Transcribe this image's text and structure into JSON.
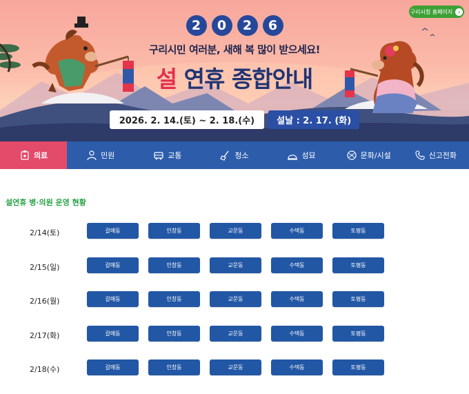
{
  "hero": {
    "year_digits": [
      "2",
      "0",
      "2",
      "6"
    ],
    "greeting": "구리시민 여러분, 새해 복 많이 받으세요!",
    "title_highlight": "설",
    "title_rest": "연휴 종합안내",
    "date_range": "2026. 2. 14.(토) ~ 2. 18.(수)",
    "seollal": "설날 : 2. 17. (화)",
    "home_link": "구리시청 홈페이지",
    "home_arrow_icon": "arrow-right-icon"
  },
  "nav": {
    "items": [
      {
        "label": "의료",
        "icon": "medical-icon"
      },
      {
        "label": "민원",
        "icon": "civil-icon"
      },
      {
        "label": "교통",
        "icon": "transport-icon"
      },
      {
        "label": "청소",
        "icon": "cleaning-icon"
      },
      {
        "label": "성묘",
        "icon": "grave-icon"
      },
      {
        "label": "문화/시설",
        "icon": "culture-icon"
      },
      {
        "label": "신고전화",
        "icon": "phone-icon"
      }
    ],
    "active_color": "#e44a6a",
    "bar_color": "#2d5cab"
  },
  "content": {
    "section_title": "설연휴 병·의원 운영 현황",
    "days": [
      {
        "date": "2/14(토)",
        "buttons": [
          "갈매동",
          "인창동",
          "교문동",
          "수택동",
          "토평동"
        ]
      },
      {
        "date": "2/15(일)",
        "buttons": [
          "갈매동",
          "인창동",
          "교문동",
          "수택동",
          "토평동"
        ]
      },
      {
        "date": "2/16(월)",
        "buttons": [
          "갈매동",
          "인창동",
          "교문동",
          "수택동",
          "토평동"
        ]
      },
      {
        "date": "2/17(화)",
        "buttons": [
          "갈매동",
          "인창동",
          "교문동",
          "수택동",
          "토평동"
        ]
      },
      {
        "date": "2/18(수)",
        "buttons": [
          "갈매동",
          "인창동",
          "교문동",
          "수택동",
          "토평동"
        ]
      }
    ]
  }
}
